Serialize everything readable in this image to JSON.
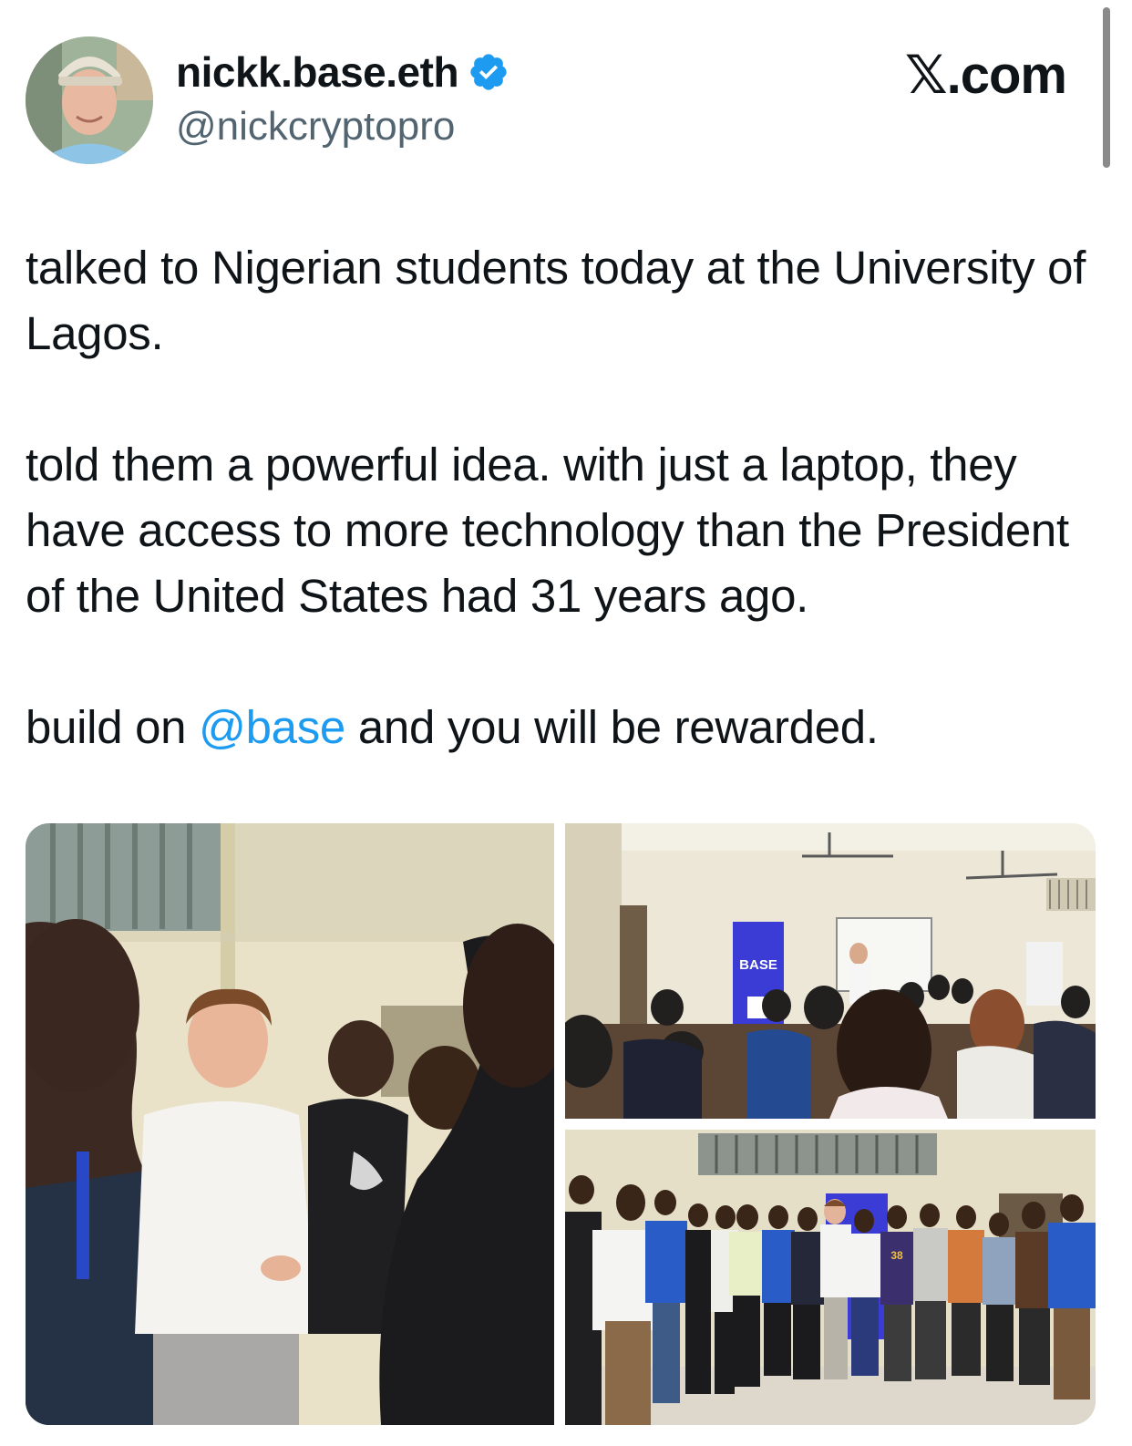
{
  "header": {
    "display_name": "nickk.base.eth",
    "verified_icon": "verified-badge-icon",
    "handle": "@nickcryptopro",
    "brand": "𝕏.com"
  },
  "tweet": {
    "paragraph_1": "talked to Nigerian students today at the University of Lagos.",
    "paragraph_2": "told them a powerful idea. with just a laptop, they have access to more technology than the President of the United States had 31 years ago.",
    "paragraph_3_before": "build on ",
    "paragraph_3_mention": "@base",
    "paragraph_3_after": " and you will be rewarded."
  },
  "media": {
    "banner_text": "BASE",
    "shirt_number": "38"
  },
  "colors": {
    "text": "#0f1419",
    "secondary": "#536471",
    "link": "#1d9bf0",
    "verified": "#1d9bf0",
    "banner": "#3b3bd6"
  }
}
